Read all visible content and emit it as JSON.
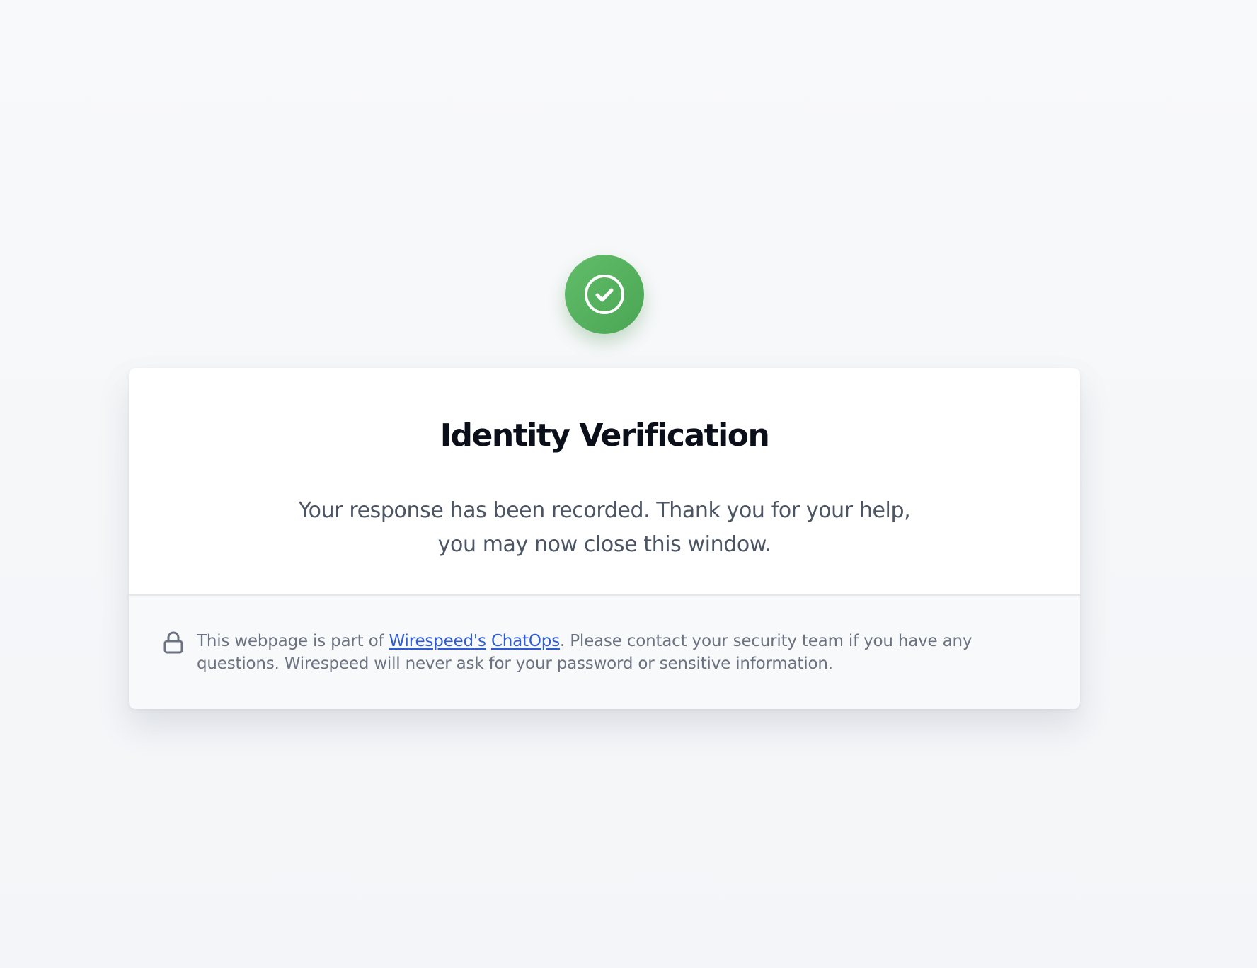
{
  "status": {
    "icon": "check-circle-icon",
    "color": "#56b05e"
  },
  "card": {
    "title": "Identity Verification",
    "message": "Your response has been recorded. Thank you for your help, you may now close this window."
  },
  "footer": {
    "icon": "lock-icon",
    "text_before": "This webpage is part of ",
    "link_1": "Wirespeed's",
    "between_links": " ",
    "link_2": "ChatOps",
    "text_after": ". Please contact your security team if you have any questions. Wirespeed will never ask for your password or sensitive information.",
    "link_color": "#2f5bd3"
  }
}
